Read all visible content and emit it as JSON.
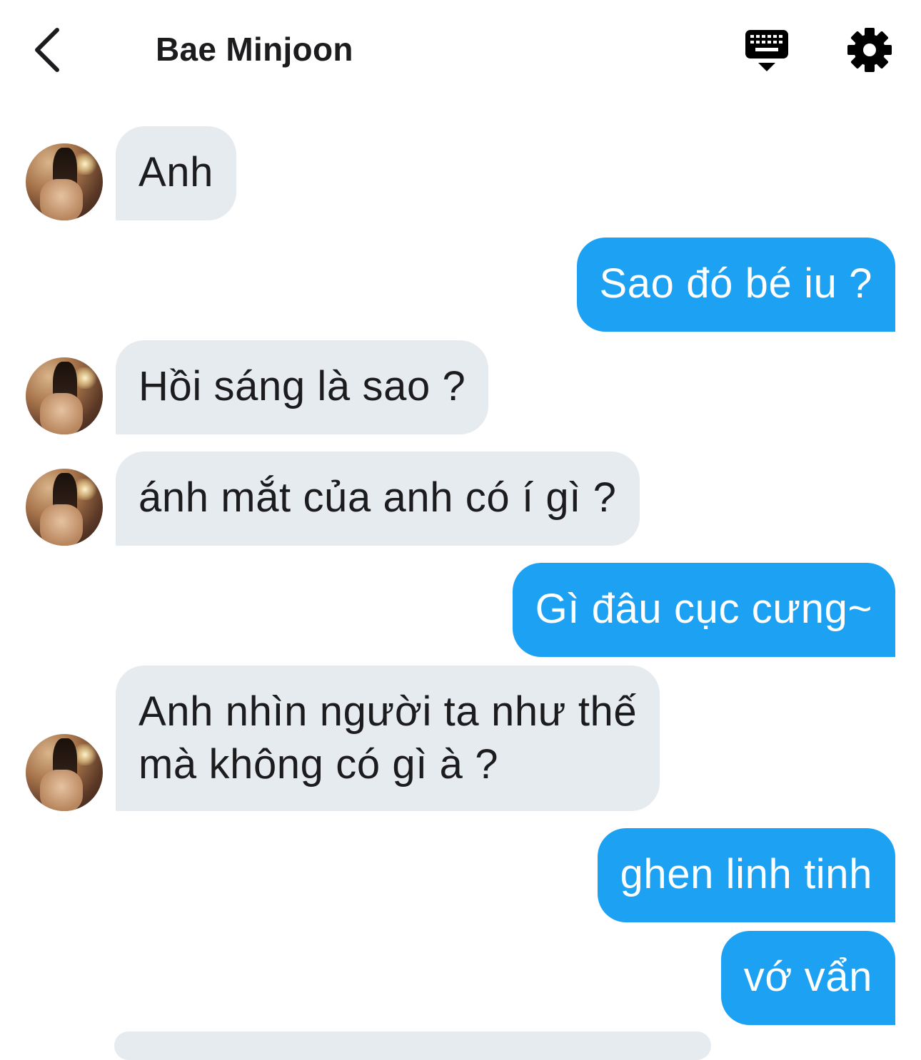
{
  "header": {
    "title": "Bae Minjoon",
    "back_icon": "chevron-left-icon",
    "keyboard_icon": "keyboard-icon",
    "settings_icon": "gear-icon"
  },
  "messages": [
    {
      "from": "them",
      "text": "Anh"
    },
    {
      "from": "me",
      "text": "Sao đó bé iu ?"
    },
    {
      "from": "them",
      "text": "Hồi sáng là sao ?"
    },
    {
      "from": "them",
      "text": "ánh mắt của anh có í gì ?"
    },
    {
      "from": "me",
      "text": "Gì đâu cục cưng~"
    },
    {
      "from": "them",
      "text_line1": "Anh nhìn người ta như thế",
      "text_line2": "mà không có gì à ?"
    },
    {
      "from": "me",
      "text": "ghen linh tinh"
    },
    {
      "from": "me",
      "text": "vớ vẩn"
    }
  ],
  "colors": {
    "outgoing_bubble": "#1da1f2",
    "incoming_bubble": "#e6ebf0",
    "text_dark": "#1c1c1e"
  }
}
